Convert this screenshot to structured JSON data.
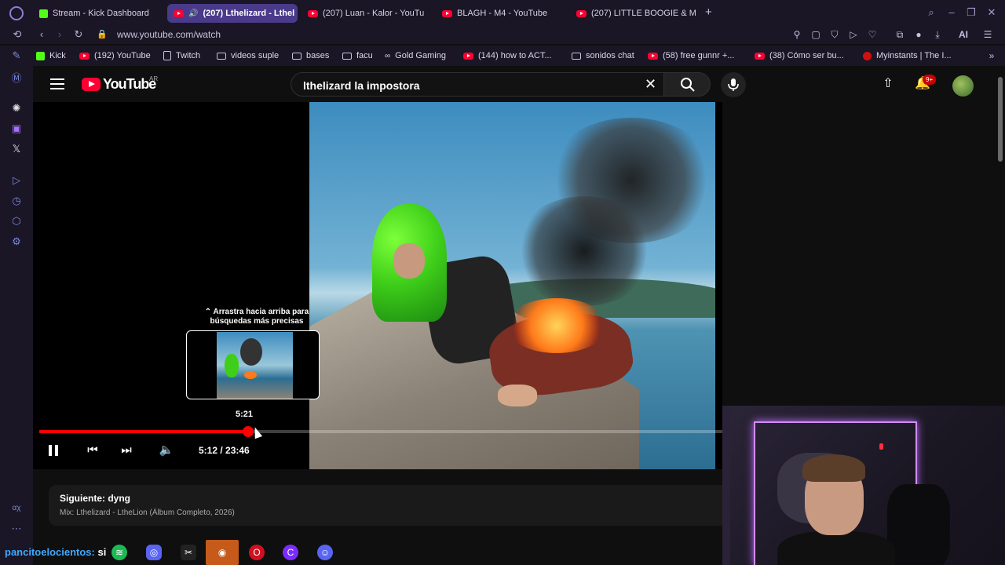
{
  "browser": {
    "tabs": [
      {
        "title": "Stream - Kick Dashboard",
        "icon": "kick-icon"
      },
      {
        "title": "(207) Lthelizard - Lthel",
        "icon": "youtube-icon",
        "active": true,
        "audio": true
      },
      {
        "title": "(207) Luan - Kalor - YouTu",
        "icon": "youtube-icon"
      },
      {
        "title": "BLAGH - M4 - YouTube",
        "icon": "youtube-icon"
      },
      {
        "title": "(207) LITTLE BOOGIE & M",
        "icon": "youtube-icon"
      }
    ],
    "new_tab": "+",
    "url": "www.youtube.com/watch",
    "ai_label": "AI",
    "bookmarks": [
      {
        "label": "Kick",
        "icon": "kick-icon"
      },
      {
        "label": "(192) YouTube",
        "icon": "youtube-icon"
      },
      {
        "label": "Twitch",
        "icon": "page-icon"
      },
      {
        "label": "videos suple",
        "icon": "folder-icon"
      },
      {
        "label": "bases",
        "icon": "folder-icon"
      },
      {
        "label": "facu",
        "icon": "folder-icon"
      },
      {
        "label": "Gold Gaming",
        "icon": "link-icon"
      },
      {
        "label": "(144) how to ACT...",
        "icon": "youtube-icon"
      },
      {
        "label": "sonidos chat",
        "icon": "folder-icon"
      },
      {
        "label": "(58) free gunnr +...",
        "icon": "youtube-icon"
      },
      {
        "label": "(38) Cómo ser bu...",
        "icon": "youtube-icon"
      },
      {
        "label": "Myinstants | The I...",
        "icon": "myinstants-icon"
      }
    ]
  },
  "youtube": {
    "logo_text": "YouTube",
    "country": "AR",
    "search_query": "lthelizard la impostora",
    "notification_count": "9+"
  },
  "player": {
    "drag_hint_arrow": "⌃",
    "drag_hint": "Arrastra hacia arriba para búsquedas más precisas",
    "preview_time": "5:21",
    "current_time": "5:12",
    "duration": "23:46",
    "time_display": "5:12 / 23:46",
    "progress_fraction": 0.306
  },
  "up_next": {
    "label": "Siguiente: dyng",
    "subtitle": "Mix: Lthelizard - LtheLion (Álbum Completo, 2026)"
  },
  "overlay": {
    "chat_user": "pancitoelocientos",
    "chat_text": "si"
  },
  "colors": {
    "accent_red": "#ff0000",
    "browser_bg": "#1a1625",
    "active_tab": "#4a3a8a"
  }
}
